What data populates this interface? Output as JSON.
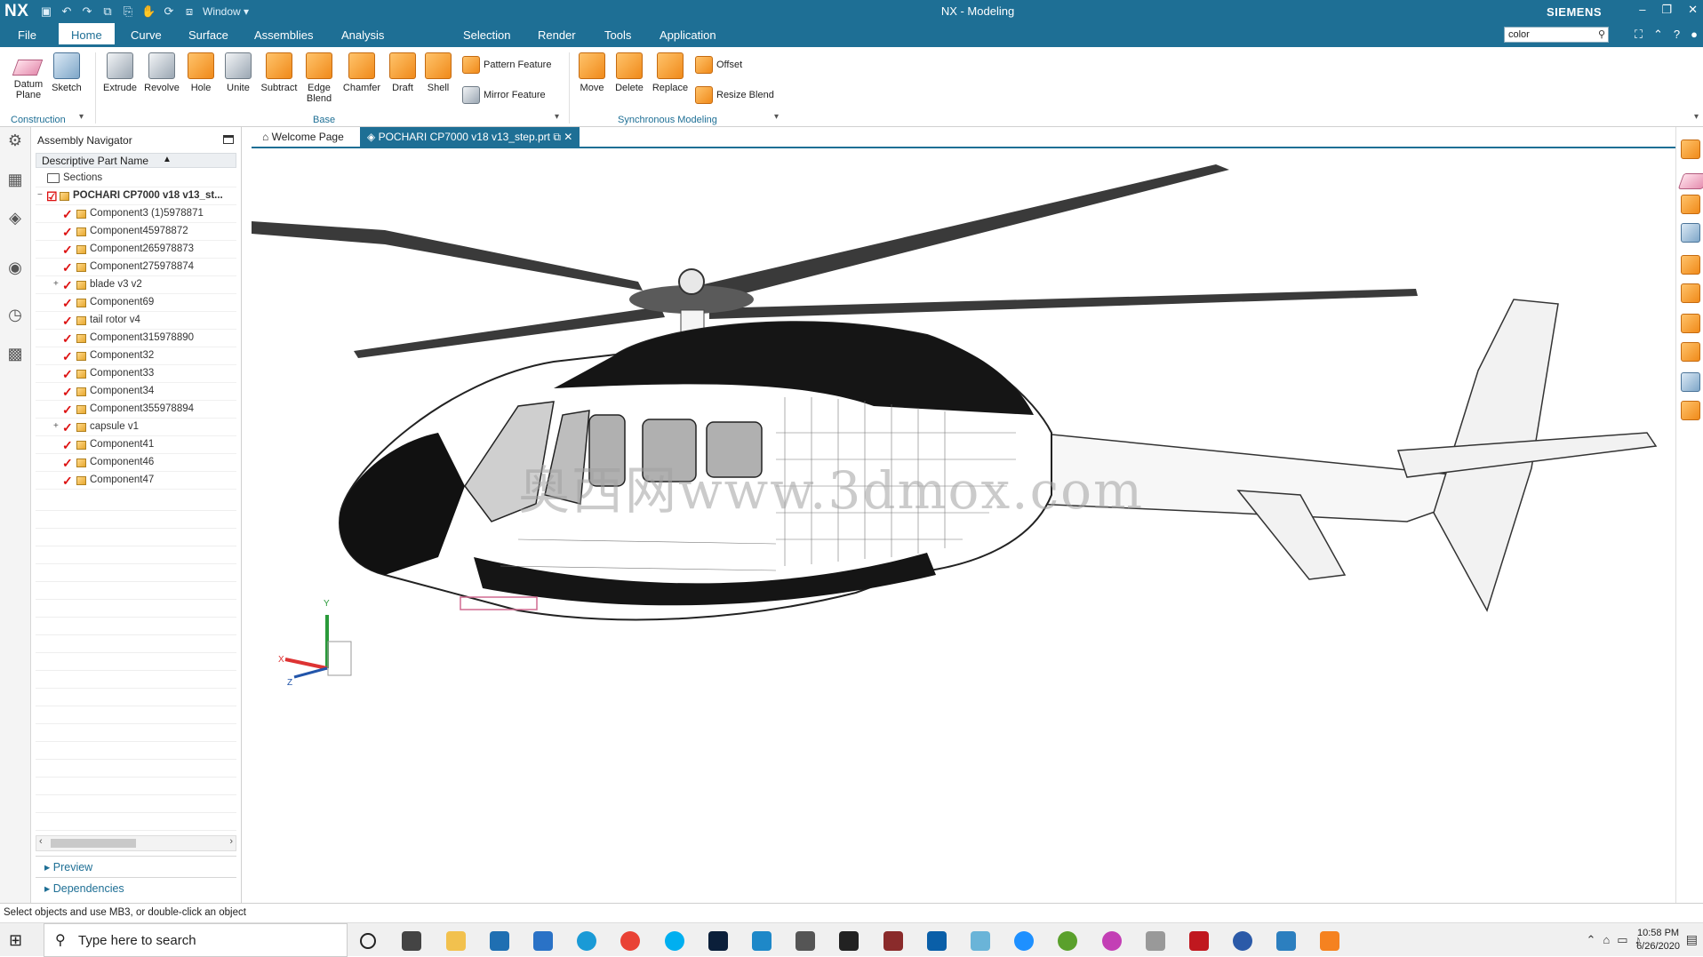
{
  "titlebar": {
    "logo": "NX",
    "title": "NX - Modeling",
    "brand": "SIEMENS",
    "window_menu": "Window",
    "controls": [
      "–",
      "❐",
      "✕"
    ]
  },
  "menubar": {
    "items": [
      "File",
      "Home",
      "Curve",
      "Surface",
      "Assemblies",
      "Analysis",
      "Selection",
      "Render",
      "Tools",
      "Application"
    ],
    "active": "Home",
    "search_value": "color"
  },
  "ribbon": {
    "construction": {
      "label": "Construction",
      "buttons": [
        "Datum Plane",
        "Sketch"
      ]
    },
    "base": {
      "label": "Base",
      "buttons": [
        "Extrude",
        "Revolve",
        "Hole",
        "Unite",
        "Subtract",
        "Edge Blend",
        "Chamfer",
        "Draft",
        "Shell"
      ],
      "small_buttons": [
        "Pattern Feature",
        "Mirror Feature"
      ]
    },
    "synchronous": {
      "label": "Synchronous Modeling",
      "buttons": [
        "Move",
        "Delete",
        "Replace"
      ],
      "small_buttons": [
        "Offset",
        "Resize Blend"
      ]
    }
  },
  "navigator": {
    "title": "Assembly Navigator",
    "column_header": "Descriptive Part Name",
    "sections_label": "Sections",
    "root": "POCHARI CP7000 v18 v13_st...",
    "components": [
      "Component3 (1)5978871",
      "Component45978872",
      "Component265978873",
      "Component275978874",
      "blade v3 v2",
      "Component69",
      "tail rotor v4",
      "Component315978890",
      "Component32",
      "Component33",
      "Component34",
      "Component355978894",
      "capsule v1",
      "Component41",
      "Component46",
      "Component47"
    ],
    "preview_label": "Preview",
    "dependencies_label": "Dependencies"
  },
  "tabs": {
    "welcome": "Welcome Page",
    "active": "POCHARI CP7000 v18 v13_step.prt"
  },
  "viewport": {
    "watermark": "奥西网www.3dmox.com",
    "axis_x": "X",
    "axis_y": "Y",
    "axis_z": "Z"
  },
  "statusbar": {
    "message": "Select objects and use MB3, or double-click an object"
  },
  "taskbar": {
    "search_placeholder": "Type here to search",
    "time": "10:58 PM",
    "date": "6/26/2020"
  }
}
